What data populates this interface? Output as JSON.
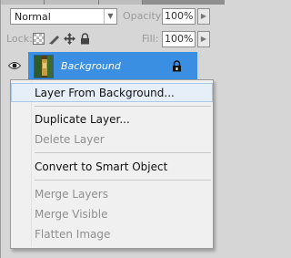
{
  "toolbar": {
    "blend_mode": "Normal",
    "opacity_label": "Opacity:",
    "opacity_value": "100%",
    "lock_label": "Lock:",
    "fill_label": "Fill:",
    "fill_value": "100%"
  },
  "layer": {
    "name": "Background",
    "visible": true,
    "locked": true
  },
  "context_menu": {
    "items": [
      {
        "label": "Layer From Background...",
        "enabled": true,
        "highlighted": true
      },
      {
        "label": "Duplicate Layer...",
        "enabled": true
      },
      {
        "label": "Delete Layer",
        "enabled": false
      },
      {
        "label": "Convert to Smart Object",
        "enabled": true
      },
      {
        "label": "Merge Layers",
        "enabled": false
      },
      {
        "label": "Merge Visible",
        "enabled": false
      },
      {
        "label": "Flatten Image",
        "enabled": false
      }
    ]
  },
  "colors": {
    "selection": "#3b8fe3",
    "menu_bg": "#f0f0f0",
    "hover_bg": "#e6eef8",
    "disabled_text": "#8f8f8f"
  }
}
